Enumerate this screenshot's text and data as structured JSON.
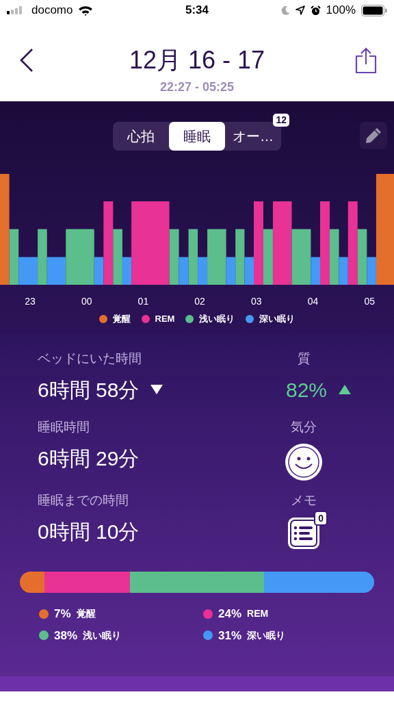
{
  "status_bar": {
    "carrier": "docomo",
    "time": "5:34",
    "battery": "100%"
  },
  "header": {
    "title": "12月 16 - 17",
    "subtitle": "22:27 - 05:25"
  },
  "tabs": [
    {
      "label": "心拍",
      "selected": false
    },
    {
      "label": "睡眠",
      "selected": true
    },
    {
      "label": "オー…",
      "selected": false
    }
  ],
  "tabs_badge": "12",
  "time_labels": [
    "23",
    "00",
    "01",
    "02",
    "03",
    "04",
    "05"
  ],
  "legend": [
    {
      "label": "覚醒",
      "color": "#e46f2c"
    },
    {
      "label": "REM",
      "color": "#e83295"
    },
    {
      "label": "浅い眠り",
      "color": "#5bbe8c"
    },
    {
      "label": "深い眠り",
      "color": "#4499f6"
    }
  ],
  "stats": [
    {
      "label": "ベッドにいた時間",
      "value": "6時間 58分",
      "trend_down": true
    },
    {
      "label": "睡眠時間",
      "value": "6時間 29分",
      "trend_down": false
    },
    {
      "label": "睡眠までの時間",
      "value": "0時間 10分",
      "trend_down": false
    }
  ],
  "quality": {
    "label": "質",
    "value": "82%",
    "trend_up": true
  },
  "mood": {
    "label": "気分"
  },
  "memo": {
    "label": "メモ",
    "count": "0"
  },
  "breakdown": [
    {
      "percent": "7%",
      "label": "覚醒",
      "color": "#e46f2c"
    },
    {
      "percent": "24%",
      "label": "REM",
      "color": "#e83295"
    },
    {
      "percent": "38%",
      "label": "浅い眠り",
      "color": "#5bbe8c"
    },
    {
      "percent": "31%",
      "label": "深い眠り",
      "color": "#4499f6"
    }
  ]
}
